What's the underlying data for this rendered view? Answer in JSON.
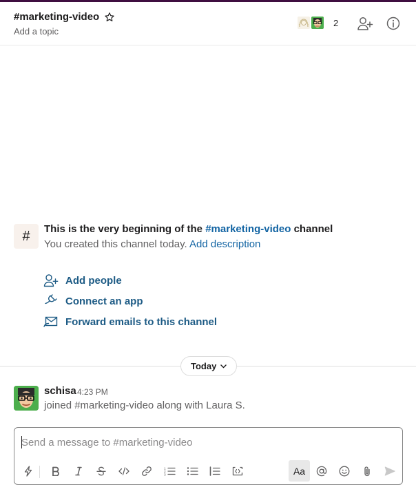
{
  "header": {
    "channel_name": "#marketing-video",
    "topic_placeholder": "Add a topic",
    "member_count": "2"
  },
  "intro": {
    "hash_symbol": "#",
    "title_prefix": "This is the very beginning of the ",
    "title_channel": "#marketing-video",
    "title_suffix": " channel",
    "subtitle": "You created this channel today.",
    "add_description": "Add description"
  },
  "actions": [
    {
      "label": "Add people",
      "icon": "add-person-icon"
    },
    {
      "label": "Connect an app",
      "icon": "plug-icon"
    },
    {
      "label": "Forward emails to this channel",
      "icon": "email-forward-icon"
    }
  ],
  "divider": {
    "label": "Today"
  },
  "message": {
    "author": "schisa",
    "time": "4:23 PM",
    "text": "joined #marketing-video along with Laura S."
  },
  "composer": {
    "placeholder": "Send a message to #marketing-video",
    "value": "",
    "format_label": "Aa"
  },
  "colors": {
    "link": "#1264a3",
    "action_link": "#1d5b85",
    "top_accent": "#3f0e40",
    "hash_bg": "#f8f1ec"
  }
}
